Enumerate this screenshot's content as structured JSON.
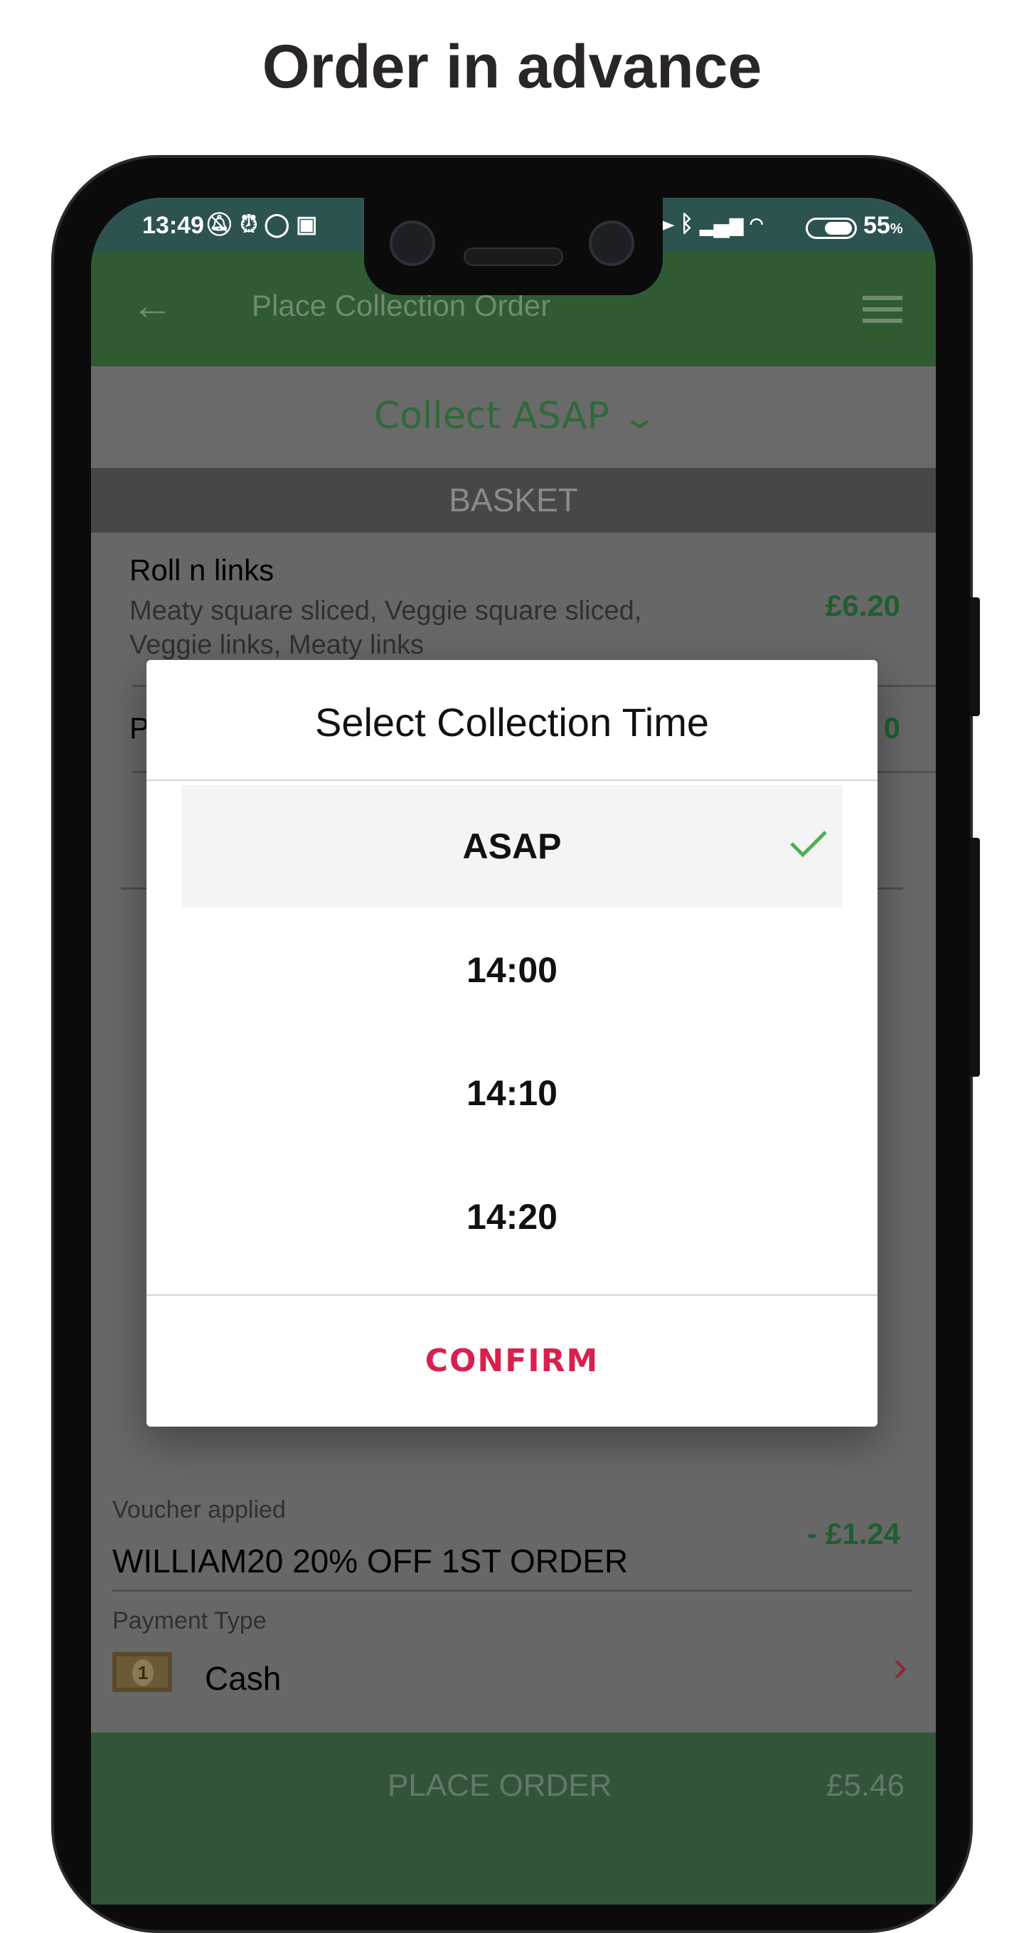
{
  "headline": "Order in advance",
  "status_bar": {
    "time": "13:49",
    "battery": "55",
    "battery_unit": "%"
  },
  "app_bar": {
    "title": "Place Collection Order",
    "back_icon": "arrow-left-icon",
    "menu_icon": "hamburger-menu-icon"
  },
  "collect": {
    "label": "Collect ASAP"
  },
  "basket": {
    "header": "BASKET",
    "items": [
      {
        "name": "Roll n links",
        "desc_line1": "Meaty square sliced, Veggie square sliced,",
        "desc_line2": "Veggie links, Meaty links",
        "price": "£6.20"
      },
      {
        "name": "P",
        "price": "0"
      }
    ]
  },
  "dialog": {
    "title": "Select Collection Time",
    "options": [
      "ASAP",
      "14:00",
      "14:10",
      "14:20"
    ],
    "selected": "ASAP",
    "confirm": "CONFIRM"
  },
  "voucher": {
    "label": "Voucher applied",
    "code": "WILLIAM20 20% OFF 1ST ORDER",
    "amount": "- £1.24"
  },
  "payment": {
    "label": "Payment Type",
    "value": "Cash",
    "icon": "cash-note-icon"
  },
  "place_order": {
    "label": "PLACE ORDER",
    "total": "£5.46"
  },
  "colors": {
    "brand_green": "#2f5a32",
    "confirm_red": "#d8204e",
    "check_green": "#4caf50"
  }
}
